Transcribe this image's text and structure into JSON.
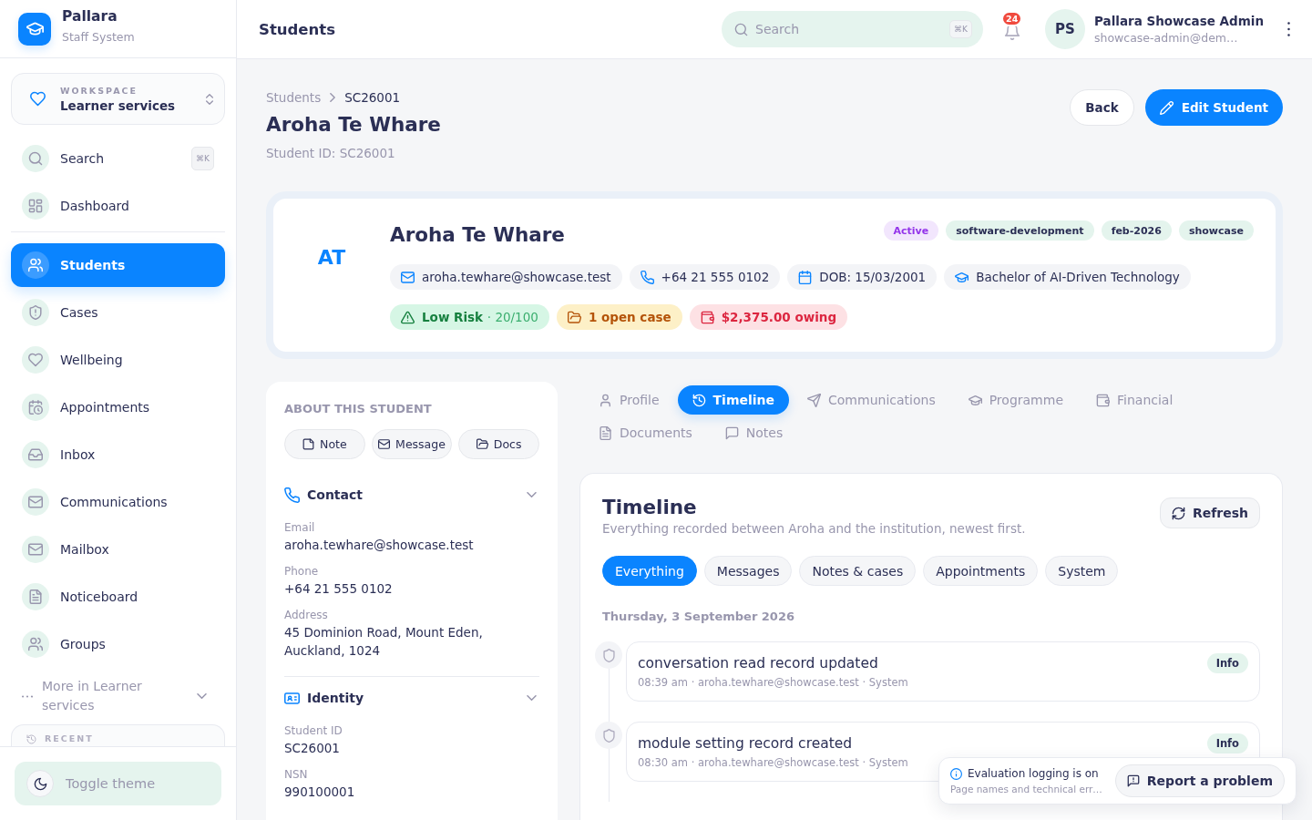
{
  "sidebar": {
    "brand": {
      "name": "Pallara",
      "subtitle": "Staff System"
    },
    "workspace": {
      "label": "WORKSPACE",
      "name": "Learner services"
    },
    "quick_items": [
      {
        "label": "Search",
        "shortcut": "⌘K",
        "selected": false
      },
      {
        "label": "Dashboard",
        "selected": false
      }
    ],
    "items": [
      {
        "label": "Students",
        "selected": true
      },
      {
        "label": "Cases",
        "selected": false
      },
      {
        "label": "Wellbeing",
        "selected": false
      },
      {
        "label": "Appointments",
        "selected": false
      },
      {
        "label": "Inbox",
        "selected": false
      },
      {
        "label": "Communications",
        "selected": false
      },
      {
        "label": "Mailbox",
        "selected": false
      },
      {
        "label": "Noticeboard",
        "selected": false
      },
      {
        "label": "Groups",
        "selected": false
      }
    ],
    "more": "More in Learner services",
    "recent_heading": "RECENT",
    "theme_toggle": "Toggle theme"
  },
  "header": {
    "title": "Students",
    "search": {
      "placeholder": "Search",
      "shortcut": "⌘K"
    },
    "notifications": "24",
    "user": {
      "initials": "PS",
      "name": "Pallara Showcase Admin",
      "email": "showcase-admin@dem…"
    }
  },
  "page": {
    "breadcrumb": [
      "Students",
      "SC26001"
    ],
    "title": "Aroha Te Whare",
    "subtitle": "Student ID: SC26001",
    "actions": [
      {
        "label": "Back",
        "kind": "secondary"
      },
      {
        "label": "Edit Student",
        "kind": "primary"
      }
    ]
  },
  "profile": {
    "initials": "AT",
    "name": "Aroha Te Whare",
    "tags": [
      {
        "label": "Active",
        "kind": "status"
      },
      {
        "label": "software-development",
        "kind": "tag"
      },
      {
        "label": "feb-2026",
        "kind": "tag"
      },
      {
        "label": "showcase",
        "kind": "tag"
      }
    ],
    "details": [
      "aroha.tewhare@showcase.test",
      "+64 21 555 0102",
      "DOB: 15/03/2001",
      "Bachelor of AI-Driven Technology"
    ],
    "indicators": [
      {
        "kind": "success",
        "label": "Low Risk",
        "detail": "· 20/100"
      },
      {
        "kind": "warning",
        "label": "1 open case"
      },
      {
        "kind": "danger",
        "label": "$2,375.00 owing"
      }
    ]
  },
  "about": {
    "heading": "ABOUT THIS STUDENT",
    "actions": [
      "Note",
      "Message",
      "Docs"
    ],
    "sections": [
      {
        "title": "Contact",
        "fields": [
          {
            "label": "Email",
            "value": "aroha.tewhare@showcase.test"
          },
          {
            "label": "Phone",
            "value": "+64 21 555 0102"
          },
          {
            "label": "Address",
            "value": "45 Dominion Road, Mount Eden, Auckland, 1024"
          }
        ]
      },
      {
        "title": "Identity",
        "fields": [
          {
            "label": "Student ID",
            "value": "SC26001"
          },
          {
            "label": "NSN",
            "value": "990100001"
          }
        ]
      }
    ]
  },
  "tabs": [
    {
      "label": "Profile",
      "selected": false
    },
    {
      "label": "Timeline",
      "selected": true
    },
    {
      "label": "Communications",
      "selected": false
    },
    {
      "label": "Programme",
      "selected": false
    },
    {
      "label": "Financial",
      "selected": false
    },
    {
      "label": "Documents",
      "selected": false
    },
    {
      "label": "Notes",
      "selected": false
    }
  ],
  "timeline": {
    "title": "Timeline",
    "description": "Everything recorded between Aroha and the institution, newest first.",
    "refresh": "Refresh",
    "filters": [
      {
        "label": "Everything",
        "selected": true
      },
      {
        "label": "Messages",
        "selected": false
      },
      {
        "label": "Notes & cases",
        "selected": false
      },
      {
        "label": "Appointments",
        "selected": false
      },
      {
        "label": "System",
        "selected": false
      }
    ],
    "date": "Thursday, 3 September 2026",
    "entries": [
      {
        "title": "conversation read record updated",
        "meta": "08:39 am · aroha.tewhare@showcase.test · System",
        "badge": "Info"
      },
      {
        "title": "module setting record created",
        "meta": "08:30 am · aroha.tewhare@showcase.test · System",
        "badge": "Info"
      }
    ]
  },
  "toast": {
    "title": "Evaluation logging is on",
    "message": "Page names and technical err…",
    "action": "Report a problem"
  }
}
